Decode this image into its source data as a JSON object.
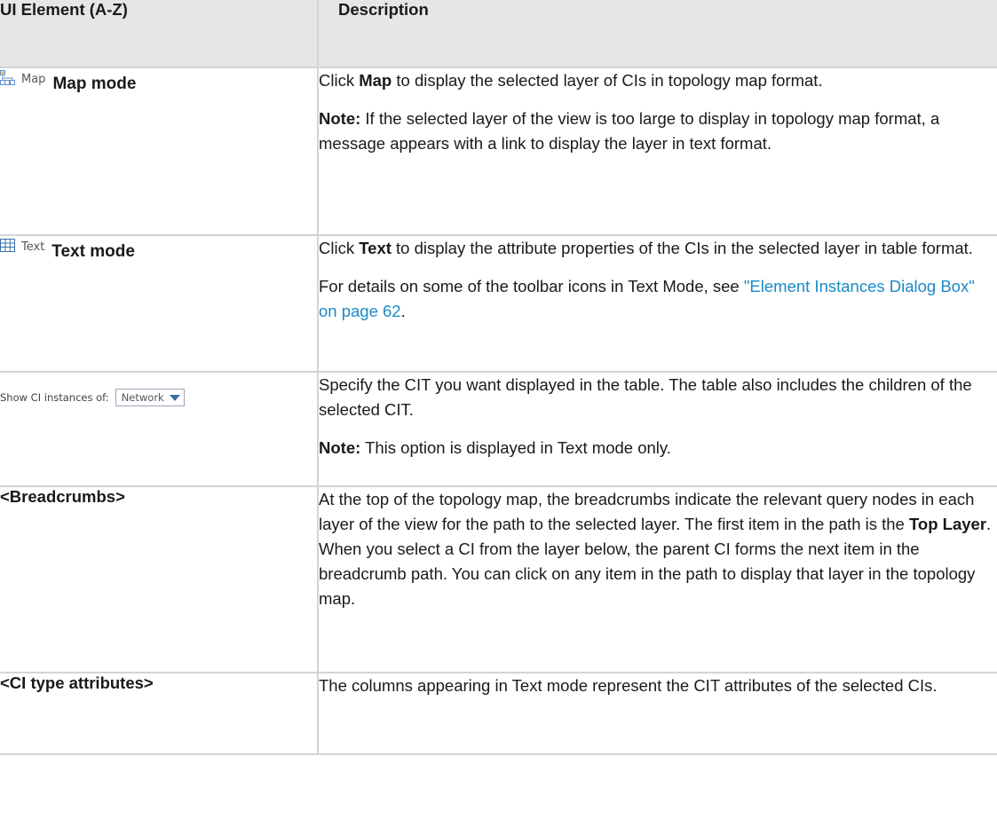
{
  "header": {
    "col1": "UI Element (A-Z)",
    "col2": "Description"
  },
  "rows": {
    "map": {
      "button_label": "Map",
      "button_icon": "map-icon",
      "title": "Map mode",
      "p1_prefix": "Click ",
      "p1_bold": "Map",
      "p1_suffix": " to display the selected layer of CIs in topology map format.",
      "note_label": "Note:",
      "note_text": " If the selected layer of the view is too large to display in topology map format, a message appears with a link to display the layer in text format."
    },
    "text": {
      "button_label": "Text",
      "button_icon": "table-grid-icon",
      "title": "Text mode",
      "p1_prefix": "Click ",
      "p1_bold": "Text",
      "p1_suffix": " to display the attribute properties of the CIs in the selected layer in table format.",
      "p2_prefix": "For details on some of the toolbar icons in Text Mode, see ",
      "p2_link": "\"Element Instances Dialog Box\" on page 62",
      "p2_suffix": "."
    },
    "show_ci": {
      "label": "Show CI instances of:",
      "selected": "Network",
      "p1": "Specify the CIT you want displayed in the table. The table also includes the children of the selected CIT.",
      "note_label": "Note:",
      "note_text": " This option is displayed in Text mode only."
    },
    "breadcrumbs": {
      "title": "<Breadcrumbs>",
      "p1_a": "At the top of the topology map, the breadcrumbs indicate the relevant query nodes in each layer of the view for the path to the selected layer. The first item in the path is the ",
      "p1_bold": "Top Layer",
      "p1_b": ". When you select a CI from the layer below, the parent CI forms the next item in the breadcrumb path. You can click on any item in the path to display that layer in the topology map."
    },
    "ci_type": {
      "title": "<CI type attributes>",
      "p1": "The columns appearing in Text mode represent the CIT attributes of the selected CIs."
    }
  },
  "colors": {
    "header_bg": "#e6e6e6",
    "border": "#d4d4d4",
    "link": "#1b8bc6"
  }
}
